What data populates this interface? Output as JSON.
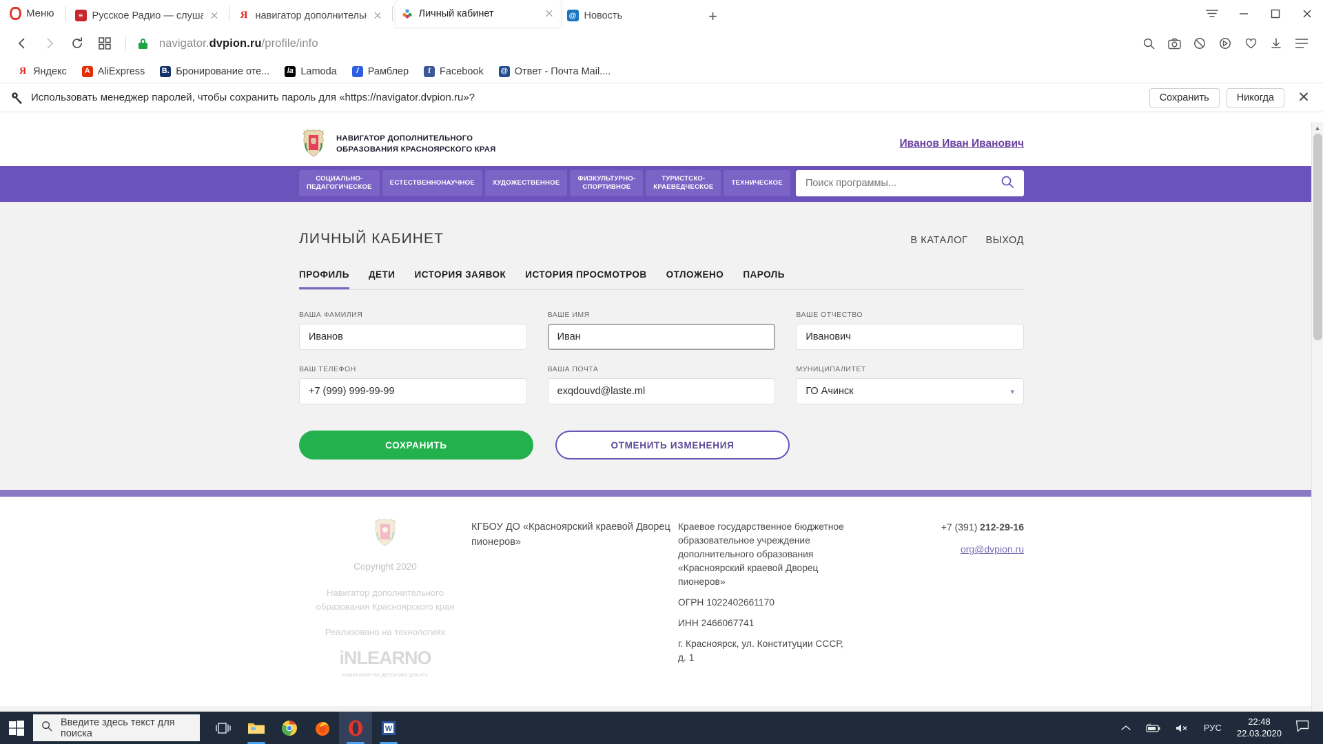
{
  "browser": {
    "menu_label": "Меню",
    "tabs": [
      {
        "title": "Русское Радио — слушать",
        "favicon": "radio-icon",
        "color": "#c8262c",
        "active": false
      },
      {
        "title": "навигатор дополнительно",
        "favicon": "yandex-icon",
        "color": "#ffffff",
        "active": false
      },
      {
        "title": "Личный кабинет",
        "favicon": "navigator-icon",
        "color": "#ffffff",
        "active": true
      },
      {
        "title": "Новость",
        "favicon": "mail-icon",
        "color": "#1a74c4",
        "active": false
      }
    ],
    "new_tab_label": "+",
    "url_prefix": "navigator.",
    "url_domain": "dvpion.ru",
    "url_path": "/profile/info",
    "bookmarks": [
      {
        "label": "Яндекс",
        "icon": "yandex-icon",
        "color": "#ffffff"
      },
      {
        "label": "AliExpress",
        "icon": "aliexpress-icon",
        "color": "#e62e04"
      },
      {
        "label": "Бронирование оте...",
        "icon": "booking-icon",
        "color": "#13346b"
      },
      {
        "label": "Lamoda",
        "icon": "lamoda-icon",
        "color": "#000000"
      },
      {
        "label": "Рамблер",
        "icon": "rambler-icon",
        "color": "#2f5fe0"
      },
      {
        "label": "Facebook",
        "icon": "facebook-icon",
        "color": "#3b5998"
      },
      {
        "label": "Ответ - Почта Mail....",
        "icon": "mailru-icon",
        "color": "#1f4c8f"
      }
    ],
    "password_bar": {
      "icon": "key-icon",
      "text": "Использовать менеджер паролей, чтобы сохранить пароль для «https://navigator.dvpion.ru»?",
      "save_label": "Сохранить",
      "never_label": "Никогда",
      "close_label": "✕"
    }
  },
  "site": {
    "brand_line1": "НАВИГАТОР ДОПОЛНИТЕЛЬНОГО",
    "brand_line2": "ОБРАЗОВАНИЯ КРАСНОЯРСКОГО КРАЯ",
    "user_link": "Иванов Иван Иванович",
    "nav": [
      "СОЦИАЛЬНО-ПЕДАГОГИЧЕСКОЕ",
      "ЕСТЕСТВЕННОНАУЧНОЕ",
      "ХУДОЖЕСТВЕННОЕ",
      "ФИЗКУЛЬТУРНО-СПОРТИВНОЕ",
      "ТУРИСТСКО-КРАЕВЕДЧЕСКОЕ",
      "ТЕХНИЧЕСКОЕ"
    ],
    "nav_lines": [
      [
        "СОЦИАЛЬНО-",
        "ПЕДАГОГИЧЕСКОЕ"
      ],
      [
        "ЕСТЕСТВЕННОНАУЧНОЕ",
        ""
      ],
      [
        "ХУДОЖЕСТВЕННОЕ",
        ""
      ],
      [
        "ФИЗКУЛЬТУРНО-",
        "СПОРТИВНОЕ"
      ],
      [
        "ТУРИСТСКО-",
        "КРАЕВЕДЧЕСКОЕ"
      ],
      [
        "ТЕХНИЧЕСКОЕ",
        ""
      ]
    ],
    "search_placeholder": "Поиск программы...",
    "accent_color": "#6c52bb"
  },
  "main": {
    "page_title": "ЛИЧНЫЙ КАБИНЕТ",
    "top_links": [
      "В КАТАЛОГ",
      "ВЫХОД"
    ],
    "tabs": [
      {
        "label": "ПРОФИЛЬ",
        "active": true
      },
      {
        "label": "ДЕТИ",
        "active": false
      },
      {
        "label": "ИСТОРИЯ ЗАЯВОК",
        "active": false
      },
      {
        "label": "ИСТОРИЯ ПРОСМОТРОВ",
        "active": false
      },
      {
        "label": "ОТЛОЖЕНО",
        "active": false
      },
      {
        "label": "ПАРОЛЬ",
        "active": false
      }
    ],
    "fields": [
      {
        "label": "ВАША ФАМИЛИЯ",
        "value": "Иванов",
        "type": "text",
        "focused": false
      },
      {
        "label": "ВАШЕ ИМЯ",
        "value": "Иван",
        "type": "text",
        "focused": true
      },
      {
        "label": "ВАШЕ ОТЧЕСТВО",
        "value": "Иванович",
        "type": "text",
        "focused": false
      },
      {
        "label": "ВАШ ТЕЛЕФОН",
        "value": "+7 (999) 999-99-99",
        "type": "text",
        "focused": false
      },
      {
        "label": "ВАША ПОЧТА",
        "value": "exqdouvd@laste.ml",
        "type": "text",
        "focused": false
      },
      {
        "label": "МУНИЦИПАЛИТЕТ",
        "value": "ГО Ачинск",
        "type": "select",
        "focused": false
      }
    ],
    "save_button": "СОХРАНИТЬ",
    "cancel_button": "ОТМЕНИТЬ ИЗМЕНЕНИЯ",
    "save_color": "#22b14c"
  },
  "footer": {
    "copyright": "Copyright 2020",
    "nav_name": "Навигатор дополнительного образования Красноярского края",
    "powered_by": "Реализовано на технологиях",
    "logo_text": "iNLEARNO",
    "logo_sub": "НАВИГАТОР ПО ДЕТСКОМУ ДОСУГУ",
    "org_short": "КГБОУ ДО «Красноярский краевой Дворец пионеров»",
    "org_full": "Краевое государственное бюджетное образовательное учреждение дополнительного образования «Красноярский краевой Дворец пионеров»",
    "ogrn": "ОГРН 1022402661170",
    "inn": "ИНН 2466067741",
    "address": "г. Красноярск, ул. Конституции СССР, д. 1",
    "phone_prefix": "+7 (391) ",
    "phone_number": "212-29-16",
    "email": "org@dvpion.ru"
  },
  "taskbar": {
    "search_placeholder": "Введите здесь текст для поиска",
    "apps": [
      {
        "name": "task-view-icon",
        "active": false
      },
      {
        "name": "file-explorer-icon",
        "active": false
      },
      {
        "name": "chrome-icon",
        "active": false
      },
      {
        "name": "firefox-icon",
        "active": false
      },
      {
        "name": "opera-icon",
        "active": true
      },
      {
        "name": "word-icon",
        "active": false
      }
    ],
    "language": "РУС",
    "time": "22:48",
    "date": "22.03.2020"
  }
}
